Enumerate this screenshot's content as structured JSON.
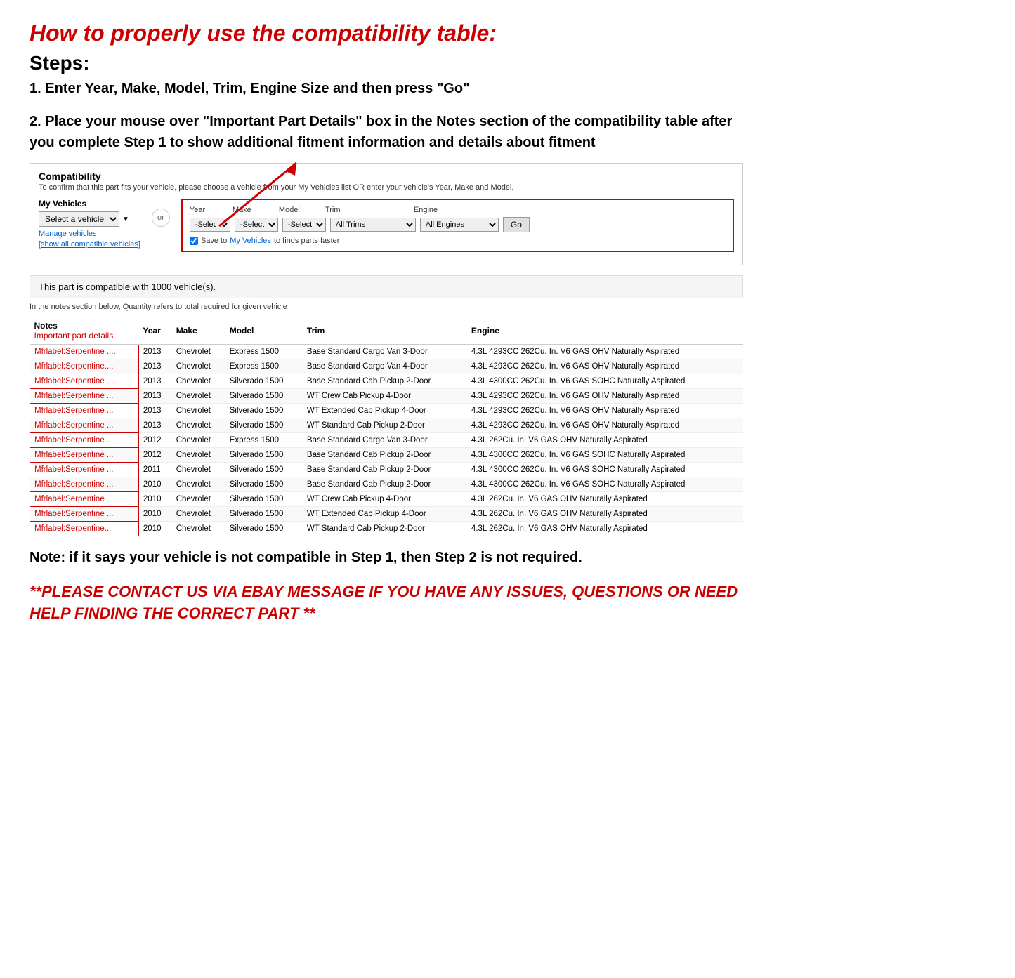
{
  "title": "How to properly use the compatibility table:",
  "steps_heading": "Steps:",
  "step1": "1. Enter Year, Make, Model, Trim, Engine Size and then press \"Go\"",
  "step2": "2. Place your mouse over \"Important Part Details\" box in the Notes section of the compatibility table after you complete Step 1 to show additional fitment information and details about fitment",
  "bottom_note": "Note: if it says your vehicle is not compatible in Step 1, then Step 2 is not required.",
  "contact_note": "**PLEASE CONTACT US VIA EBAY MESSAGE IF YOU HAVE ANY ISSUES, QUESTIONS OR NEED HELP FINDING THE CORRECT PART **",
  "compat": {
    "title": "Compatibility",
    "subtitle": "To confirm that this part fits your vehicle, please choose a vehicle from your My Vehicles list OR enter your vehicle's Year, Make and Model.",
    "my_vehicles_label": "My Vehicles",
    "select_vehicle_placeholder": "Select a vehicle",
    "manage_vehicles": "Manage vehicles",
    "show_all": "[show all compatible vehicles]",
    "or_label": "or",
    "year_label": "Year",
    "make_label": "Make",
    "model_label": "Model",
    "trim_label": "Trim",
    "engine_label": "Engine",
    "year_value": "-Select-",
    "make_value": "-Select-",
    "model_value": "-Select-",
    "trim_value": "All Trims",
    "engine_value": "All Engines",
    "go_label": "Go",
    "save_text": "Save to",
    "save_link": "My Vehicles",
    "save_suffix": "to finds parts faster",
    "compatible_notice": "This part is compatible with 1000 vehicle(s).",
    "quantity_note": "In the notes section below, Quantity refers to total required for given vehicle",
    "table_headers": [
      "Notes",
      "Year",
      "Make",
      "Model",
      "Trim",
      "Engine"
    ],
    "notes_sub": "Important part details",
    "rows": [
      {
        "notes": "Mfrlabel:Serpentine ....",
        "year": "2013",
        "make": "Chevrolet",
        "model": "Express 1500",
        "trim": "Base Standard Cargo Van 3-Door",
        "engine": "4.3L 4293CC 262Cu. In. V6 GAS OHV Naturally Aspirated"
      },
      {
        "notes": "Mfrlabel:Serpentine....",
        "year": "2013",
        "make": "Chevrolet",
        "model": "Express 1500",
        "trim": "Base Standard Cargo Van 4-Door",
        "engine": "4.3L 4293CC 262Cu. In. V6 GAS OHV Naturally Aspirated"
      },
      {
        "notes": "Mfrlabel:Serpentine ....",
        "year": "2013",
        "make": "Chevrolet",
        "model": "Silverado 1500",
        "trim": "Base Standard Cab Pickup 2-Door",
        "engine": "4.3L 4300CC 262Cu. In. V6 GAS SOHC Naturally Aspirated"
      },
      {
        "notes": "Mfrlabel:Serpentine ...",
        "year": "2013",
        "make": "Chevrolet",
        "model": "Silverado 1500",
        "trim": "WT Crew Cab Pickup 4-Door",
        "engine": "4.3L 4293CC 262Cu. In. V6 GAS OHV Naturally Aspirated"
      },
      {
        "notes": "Mfrlabel:Serpentine ...",
        "year": "2013",
        "make": "Chevrolet",
        "model": "Silverado 1500",
        "trim": "WT Extended Cab Pickup 4-Door",
        "engine": "4.3L 4293CC 262Cu. In. V6 GAS OHV Naturally Aspirated"
      },
      {
        "notes": "Mfrlabel:Serpentine ...",
        "year": "2013",
        "make": "Chevrolet",
        "model": "Silverado 1500",
        "trim": "WT Standard Cab Pickup 2-Door",
        "engine": "4.3L 4293CC 262Cu. In. V6 GAS OHV Naturally Aspirated"
      },
      {
        "notes": "Mfrlabel:Serpentine ...",
        "year": "2012",
        "make": "Chevrolet",
        "model": "Express 1500",
        "trim": "Base Standard Cargo Van 3-Door",
        "engine": "4.3L 262Cu. In. V6 GAS OHV Naturally Aspirated"
      },
      {
        "notes": "Mfrlabel:Serpentine ...",
        "year": "2012",
        "make": "Chevrolet",
        "model": "Silverado 1500",
        "trim": "Base Standard Cab Pickup 2-Door",
        "engine": "4.3L 4300CC 262Cu. In. V6 GAS SOHC Naturally Aspirated"
      },
      {
        "notes": "Mfrlabel:Serpentine ...",
        "year": "2011",
        "make": "Chevrolet",
        "model": "Silverado 1500",
        "trim": "Base Standard Cab Pickup 2-Door",
        "engine": "4.3L 4300CC 262Cu. In. V6 GAS SOHC Naturally Aspirated"
      },
      {
        "notes": "Mfrlabel:Serpentine ...",
        "year": "2010",
        "make": "Chevrolet",
        "model": "Silverado 1500",
        "trim": "Base Standard Cab Pickup 2-Door",
        "engine": "4.3L 4300CC 262Cu. In. V6 GAS SOHC Naturally Aspirated"
      },
      {
        "notes": "Mfrlabel:Serpentine ...",
        "year": "2010",
        "make": "Chevrolet",
        "model": "Silverado 1500",
        "trim": "WT Crew Cab Pickup 4-Door",
        "engine": "4.3L 262Cu. In. V6 GAS OHV Naturally Aspirated"
      },
      {
        "notes": "Mfrlabel:Serpentine ...",
        "year": "2010",
        "make": "Chevrolet",
        "model": "Silverado 1500",
        "trim": "WT Extended Cab Pickup 4-Door",
        "engine": "4.3L 262Cu. In. V6 GAS OHV Naturally Aspirated"
      },
      {
        "notes": "Mfrlabel:Serpentine...",
        "year": "2010",
        "make": "Chevrolet",
        "model": "Silverado 1500",
        "trim": "WT Standard Cab Pickup 2-Door",
        "engine": "4.3L 262Cu. In. V6 GAS OHV Naturally Aspirated"
      }
    ]
  }
}
